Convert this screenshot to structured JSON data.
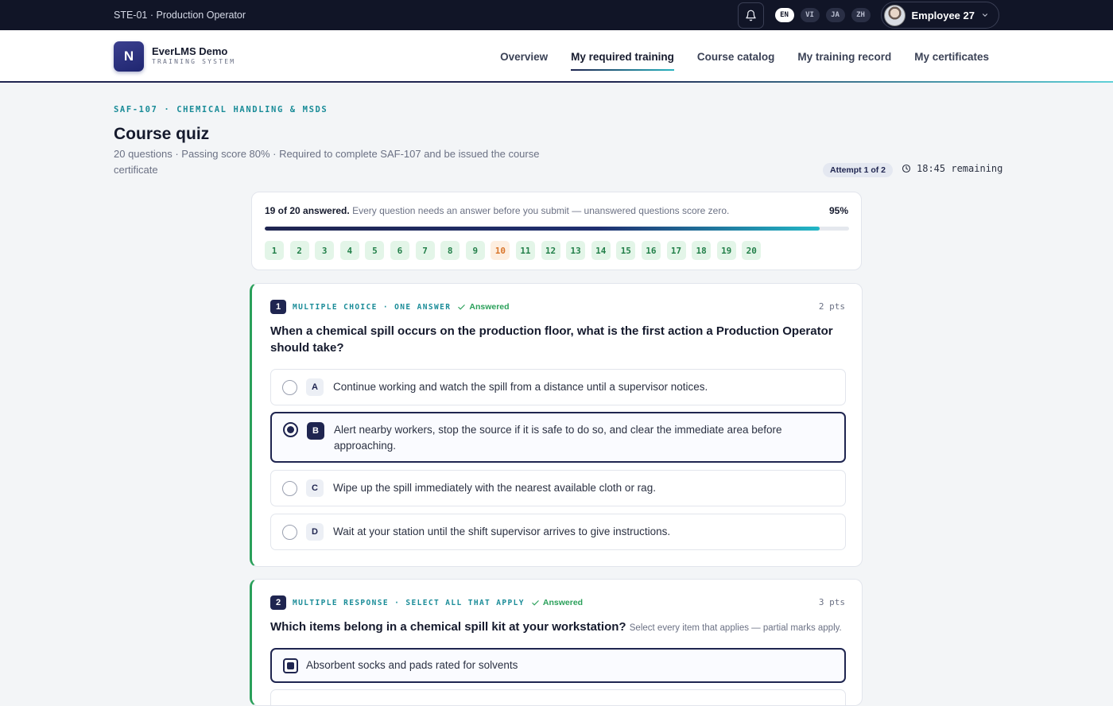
{
  "topbar": {
    "org": "STE-01 · Production Operator",
    "languages": [
      "EN",
      "VI",
      "JA",
      "ZH"
    ],
    "user": "Employee 27"
  },
  "brand": {
    "title": "EverLMS Demo",
    "subtitle": "TRAINING SYSTEM"
  },
  "nav": {
    "items": [
      "Overview",
      "My required training",
      "Course catalog",
      "My training record",
      "My certificates"
    ],
    "active": "My required training"
  },
  "page": {
    "breadcrumb": "SAF-107 · CHEMICAL HANDLING & MSDS",
    "title": "Course quiz",
    "subtitle": "20 questions · Passing score 80% · Required to complete SAF-107 and be issued the course certificate",
    "attempt": "Attempt 1 of 2",
    "timer": "18:45 remaining"
  },
  "progress": {
    "answered_label": "19 of 20 answered.",
    "note": "Every question needs an answer before you submit — unanswered questions score zero.",
    "percent_label": "95%",
    "fraction": 0.95,
    "numbers": [
      "1",
      "2",
      "3",
      "4",
      "5",
      "6",
      "7",
      "8",
      "9",
      "10",
      "11",
      "12",
      "13",
      "14",
      "15",
      "16",
      "17",
      "18",
      "19",
      "20"
    ],
    "unanswered": "10"
  },
  "questions": [
    {
      "number": "1",
      "type": "MULTIPLE CHOICE · ONE ANSWER",
      "status": "Answered",
      "points": "2 pts",
      "text": "When a chemical spill occurs on the production floor, what is the first action a Production Operator should take?",
      "options": [
        {
          "letter": "A",
          "text": "Continue working and watch the spill from a distance until a supervisor notices."
        },
        {
          "letter": "B",
          "text": "Alert nearby workers, stop the source if it is safe to do so, and clear the immediate area before approaching."
        },
        {
          "letter": "C",
          "text": "Wipe up the spill immediately with the nearest available cloth or rag."
        },
        {
          "letter": "D",
          "text": "Wait at your station until the shift supervisor arrives to give instructions."
        }
      ],
      "selected": "B"
    },
    {
      "number": "2",
      "type": "MULTIPLE RESPONSE · SELECT ALL THAT APPLY",
      "status": "Answered",
      "points": "3 pts",
      "text": "Which items belong in a chemical spill kit at your workstation?",
      "hint": "Select every item that applies — partial marks apply.",
      "options": [
        {
          "text": "Absorbent socks and pads rated for solvents",
          "checked": true
        }
      ]
    }
  ],
  "colors": {
    "navy": "#1f2550",
    "teal": "#1a8c98",
    "answered_green": "#2aa05a",
    "unanswered_orange": "#d9762c"
  }
}
